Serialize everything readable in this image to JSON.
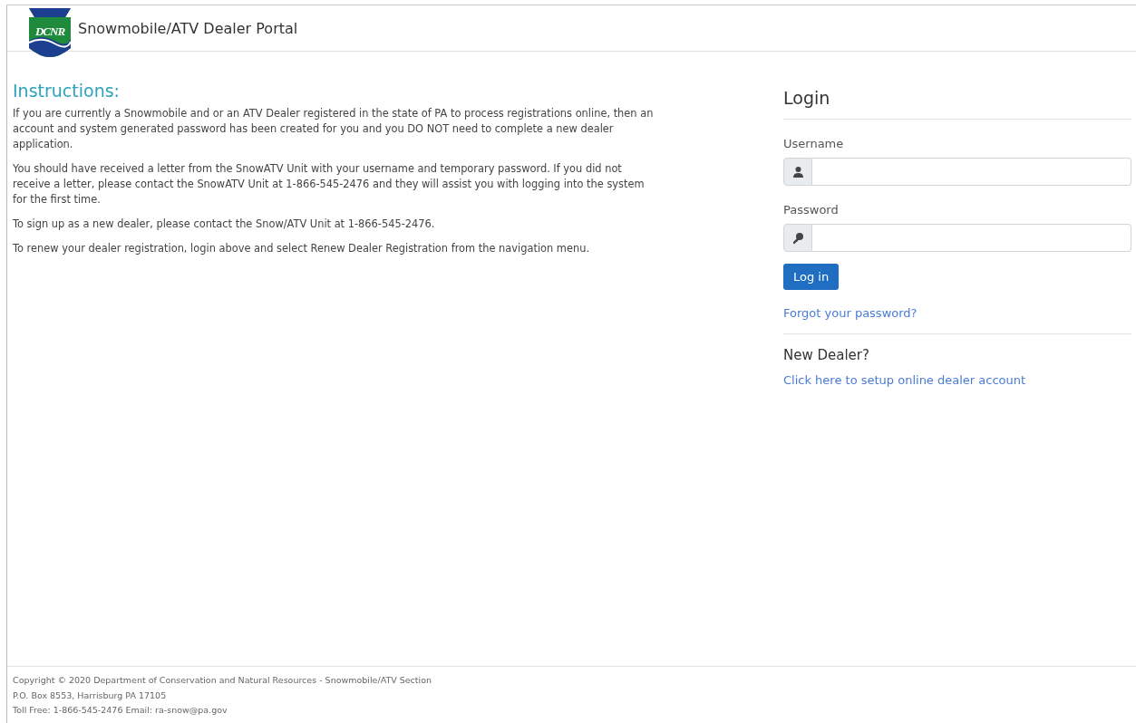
{
  "header": {
    "logo_text": "DCNR",
    "title": "Snowmobile/ATV Dealer Portal"
  },
  "instructions": {
    "heading": "Instructions:",
    "paragraphs": [
      "If you are currently a Snowmobile and or an ATV Dealer registered in the state of PA to process registrations online, then an account and system generated password has been created for you and you DO NOT need to complete a new dealer application.",
      "You should have received a letter from the SnowATV Unit with your username and temporary password. If you did not receive a letter, please contact the SnowATV Unit at 1-866-545-2476 and they will assist you with logging into the system for the first time.",
      "To sign up as a new dealer, please contact the Snow/ATV Unit at 1-866-545-2476.",
      "To renew your dealer registration, login above and select Renew Dealer Registration from the navigation menu."
    ]
  },
  "login": {
    "heading": "Login",
    "fields": [
      {
        "label": "Username",
        "kind": "user"
      },
      {
        "label": "Password",
        "kind": "key"
      }
    ],
    "button": "Log in",
    "forgot_link": "Forgot your password?"
  },
  "new_dealer": {
    "heading": "New Dealer?",
    "link": "Click here to setup online dealer account"
  },
  "footer": {
    "lines": [
      "Copyright © 2020 Department of Conservation and Natural Resources - Snowmobile/ATV Section",
      "P.O. Box 8553, Harrisburg PA 17105",
      "Toll Free: 1-866-545-2476 Email: ra-snow@pa.gov"
    ]
  }
}
